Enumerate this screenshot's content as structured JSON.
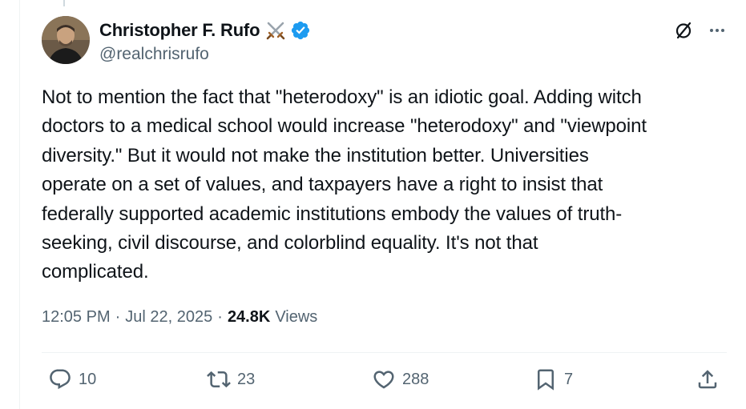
{
  "author": {
    "display_name": "Christopher F. Rufo",
    "handle": "@realchrisrufo",
    "emoji": "crossed-swords",
    "verified": true
  },
  "tweet": {
    "text": "Not to mention the fact that \"heterodoxy\" is an idiotic goal. Adding witch\ndoctors to a medical school would increase \"heterodoxy\" and \"viewpoint\ndiversity.\" But it would not make the institution better. Universities\noperate on a set of values, and taxpayers have a right to insist that\nfederally supported academic institutions embody the values of truth-\nseeking, civil discourse, and colorblind equality. It's not that\ncomplicated.",
    "time": "12:05 PM",
    "separator": "·",
    "date": "Jul 22, 2025",
    "views_count": "24.8K",
    "views_label": "Views"
  },
  "actions": {
    "replies": "10",
    "reposts": "23",
    "likes": "288",
    "bookmarks": "7"
  },
  "icons": {
    "grok": "grok-icon",
    "more": "more-icon",
    "reply": "reply-icon",
    "repost": "repost-icon",
    "like": "like-icon",
    "bookmark": "bookmark-icon",
    "share": "share-icon"
  },
  "colors": {
    "text": "#0f1419",
    "secondary": "#536471",
    "verified_blue": "#1d9bf0",
    "divider": "#eff3f4"
  }
}
